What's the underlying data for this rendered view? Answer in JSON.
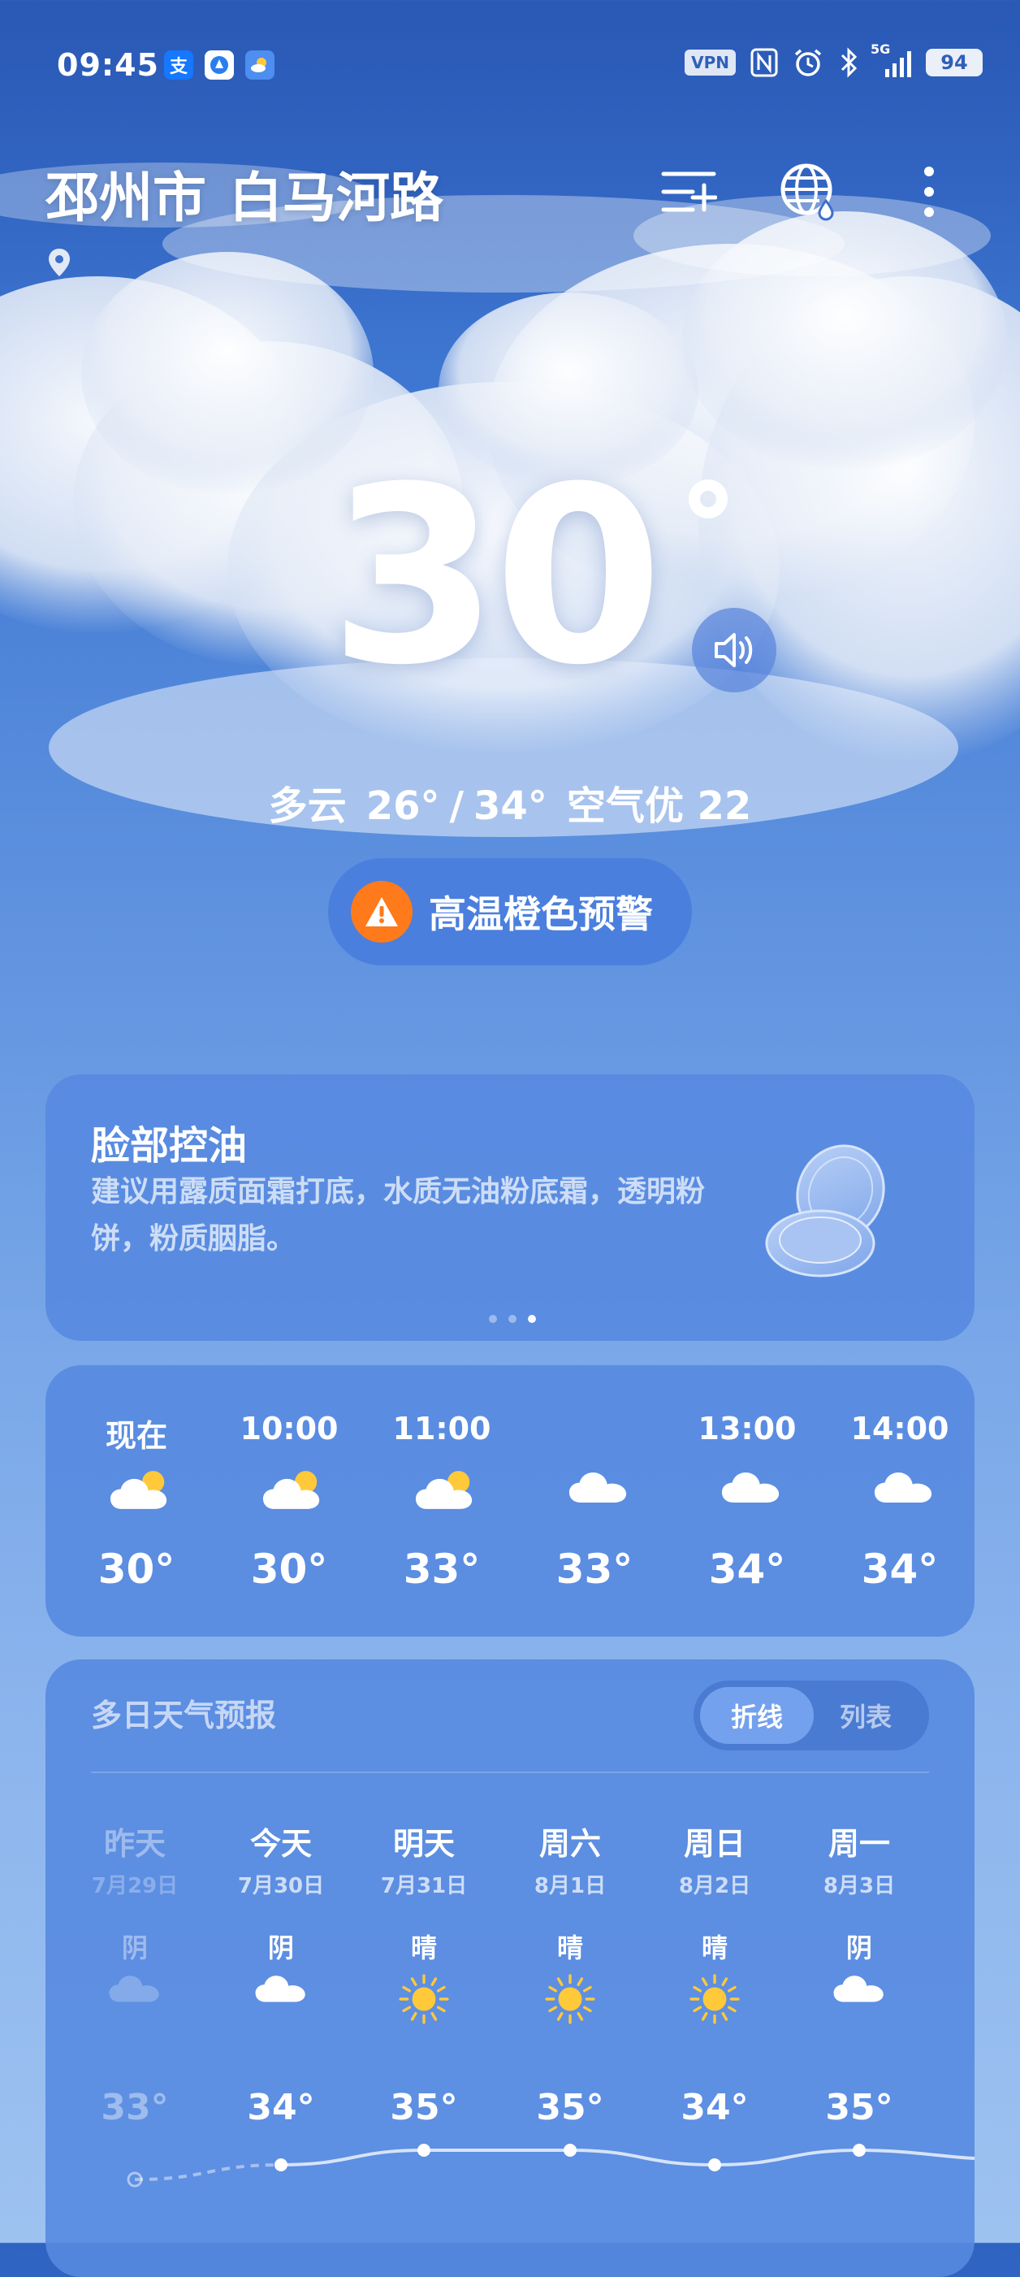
{
  "status_bar": {
    "time": "09:45",
    "vpn": "VPN",
    "network": "5G",
    "battery": "94",
    "icons": [
      "alipay-icon",
      "browser-icon",
      "weather-icon",
      "vpn-icon",
      "nfc-icon",
      "alarm-icon",
      "bluetooth-icon",
      "signal-icon",
      "battery-icon"
    ]
  },
  "header": {
    "city": "邳州市",
    "street": "白马河路",
    "icons": [
      "location-pin-icon",
      "add-city-icon",
      "globe-icon",
      "more-icon"
    ]
  },
  "current": {
    "temperature": "30",
    "condition": "多云",
    "low": "26°",
    "separator": "/",
    "high": "34°",
    "air_quality": "空气优 22",
    "alert": "高温橙色预警"
  },
  "tip_card": {
    "title": "脸部控油",
    "body": "建议用露质面霜打底，水质无油粉底霜，透明粉饼，粉质胭脂。",
    "page_count": 3,
    "active_page": 3
  },
  "hourly": [
    {
      "time": "现在",
      "icon": "partly-cloudy-icon",
      "temp": "30°"
    },
    {
      "time": "10:00",
      "icon": "partly-cloudy-icon",
      "temp": "30°"
    },
    {
      "time": "11:00",
      "icon": "partly-cloudy-icon",
      "temp": "33°"
    },
    {
      "time": "",
      "icon": "cloudy-icon",
      "temp": "33°"
    },
    {
      "time": "13:00",
      "icon": "cloudy-icon",
      "temp": "34°"
    },
    {
      "time": "14:00",
      "icon": "cloudy-icon",
      "temp": "34°"
    }
  ],
  "forecast": {
    "title": "多日天气预报",
    "toggle_line": "折线",
    "toggle_list": "列表",
    "days": [
      {
        "name": "昨天",
        "date": "7月29日",
        "condition": "阴",
        "icon": "cloudy-icon",
        "high": "33°",
        "high_value": 33,
        "past": true
      },
      {
        "name": "今天",
        "date": "7月30日",
        "condition": "阴",
        "icon": "cloudy-icon",
        "high": "34°",
        "high_value": 34,
        "past": false
      },
      {
        "name": "明天",
        "date": "7月31日",
        "condition": "晴",
        "icon": "sunny-icon",
        "high": "35°",
        "high_value": 35,
        "past": false
      },
      {
        "name": "周六",
        "date": "8月1日",
        "condition": "晴",
        "icon": "sunny-icon",
        "high": "35°",
        "high_value": 35,
        "past": false
      },
      {
        "name": "周日",
        "date": "8月2日",
        "condition": "晴",
        "icon": "sunny-icon",
        "high": "34°",
        "high_value": 34,
        "past": false
      },
      {
        "name": "周一",
        "date": "8月3日",
        "condition": "阴",
        "icon": "cloudy-icon",
        "high": "35°",
        "high_value": 35,
        "past": false
      }
    ]
  },
  "colors": {
    "alert_orange": "#ff7a1a",
    "sun_yellow": "#ffc93a",
    "card_blue": "#568ae0"
  }
}
